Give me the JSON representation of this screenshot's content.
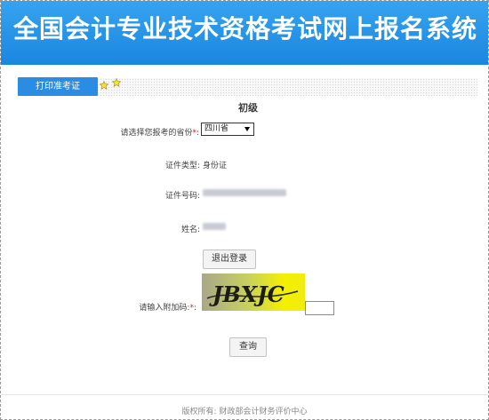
{
  "header": {
    "title": "全国会计专业技术资格考试网上报名系统"
  },
  "tab": {
    "label": "打印准考证"
  },
  "section": {
    "title": "初级"
  },
  "form": {
    "province_label": "请选择您报考的省份",
    "province_value": "四川省",
    "id_type_label": "证件类型:",
    "id_type_value": "身份证",
    "id_number_label": "证件号码:",
    "name_label": "姓名:",
    "captcha_label": "请输入附加码:",
    "captcha_text": "JBXJC",
    "required_mark": "*",
    "colon": ":"
  },
  "buttons": {
    "logout": "退出登录",
    "query": "查询"
  },
  "footer": {
    "text": "版权所有:  财政部会计财务评价中心"
  },
  "colors": {
    "header": "#1f8ee6",
    "tab": "#2a8de3",
    "required": "#e02020"
  }
}
